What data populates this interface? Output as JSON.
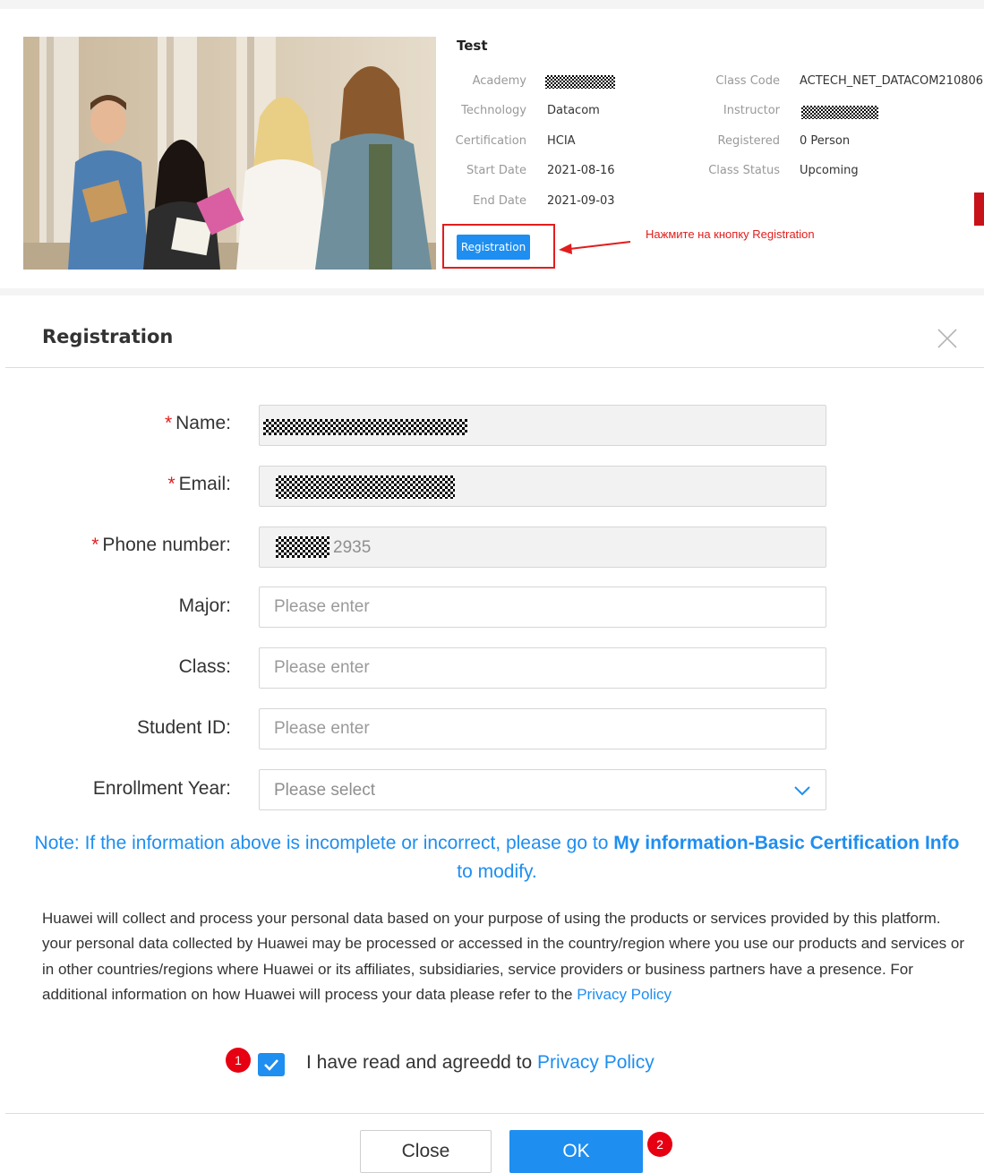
{
  "class_card": {
    "title": "Test",
    "fields_left": [
      {
        "label": "Academy",
        "value": ""
      },
      {
        "label": "Technology",
        "value": "Datacom"
      },
      {
        "label": "Certification",
        "value": "HCIA"
      },
      {
        "label": "Start Date",
        "value": "2021-08-16"
      },
      {
        "label": "End Date",
        "value": "2021-09-03"
      }
    ],
    "fields_right": [
      {
        "label": "Class Code",
        "value": "ACTECH_NET_DATACOM210806"
      },
      {
        "label": "Instructor",
        "value": ""
      },
      {
        "label": "Registered",
        "value": "0 Person"
      },
      {
        "label": "Class Status",
        "value": "Upcoming"
      }
    ],
    "registration_button": "Registration",
    "annotation": "Нажмите на кнопку Registration",
    "accent_color": "#e21d1d"
  },
  "modal": {
    "title": "Registration",
    "fields": [
      {
        "label": "Name:",
        "required": true,
        "value": ""
      },
      {
        "label": "Email:",
        "required": true,
        "value": ""
      },
      {
        "label": "Phone number:",
        "required": true,
        "value": "2935"
      },
      {
        "label": "Major:",
        "required": false,
        "placeholder": "Please enter"
      },
      {
        "label": "Class:",
        "required": false,
        "placeholder": "Please enter"
      },
      {
        "label": "Student ID:",
        "required": false,
        "placeholder": "Please enter"
      },
      {
        "label": "Enrollment Year:",
        "required": false,
        "placeholder": "Please select"
      }
    ],
    "required_mark": "*",
    "note_prefix": "Note: If the information above is incomplete or incorrect, please go to ",
    "note_bold": "My information-Basic Certification Info",
    "note_suffix": " to modify.",
    "disclaimer": "Huawei will collect and process your personal data based on your purpose of using the products or services provided by this platform. your personal data collected by Huawei may be processed or accessed in the country/region where you use our products and services or in other countries/regions where Huawei or its affiliates, subsidiaries, service providers or business partners have a presence. For additional information on how Huawei will process your data please refer to the ",
    "privacy_link": "Privacy Policy",
    "consent_text": "I have read and agreedd to ",
    "consent_link": "Privacy Policy",
    "consent_checked": true,
    "close_button": "Close",
    "ok_button": "OK",
    "badge_1": "1",
    "badge_2": "2",
    "primary_color": "#1e8ef0"
  }
}
